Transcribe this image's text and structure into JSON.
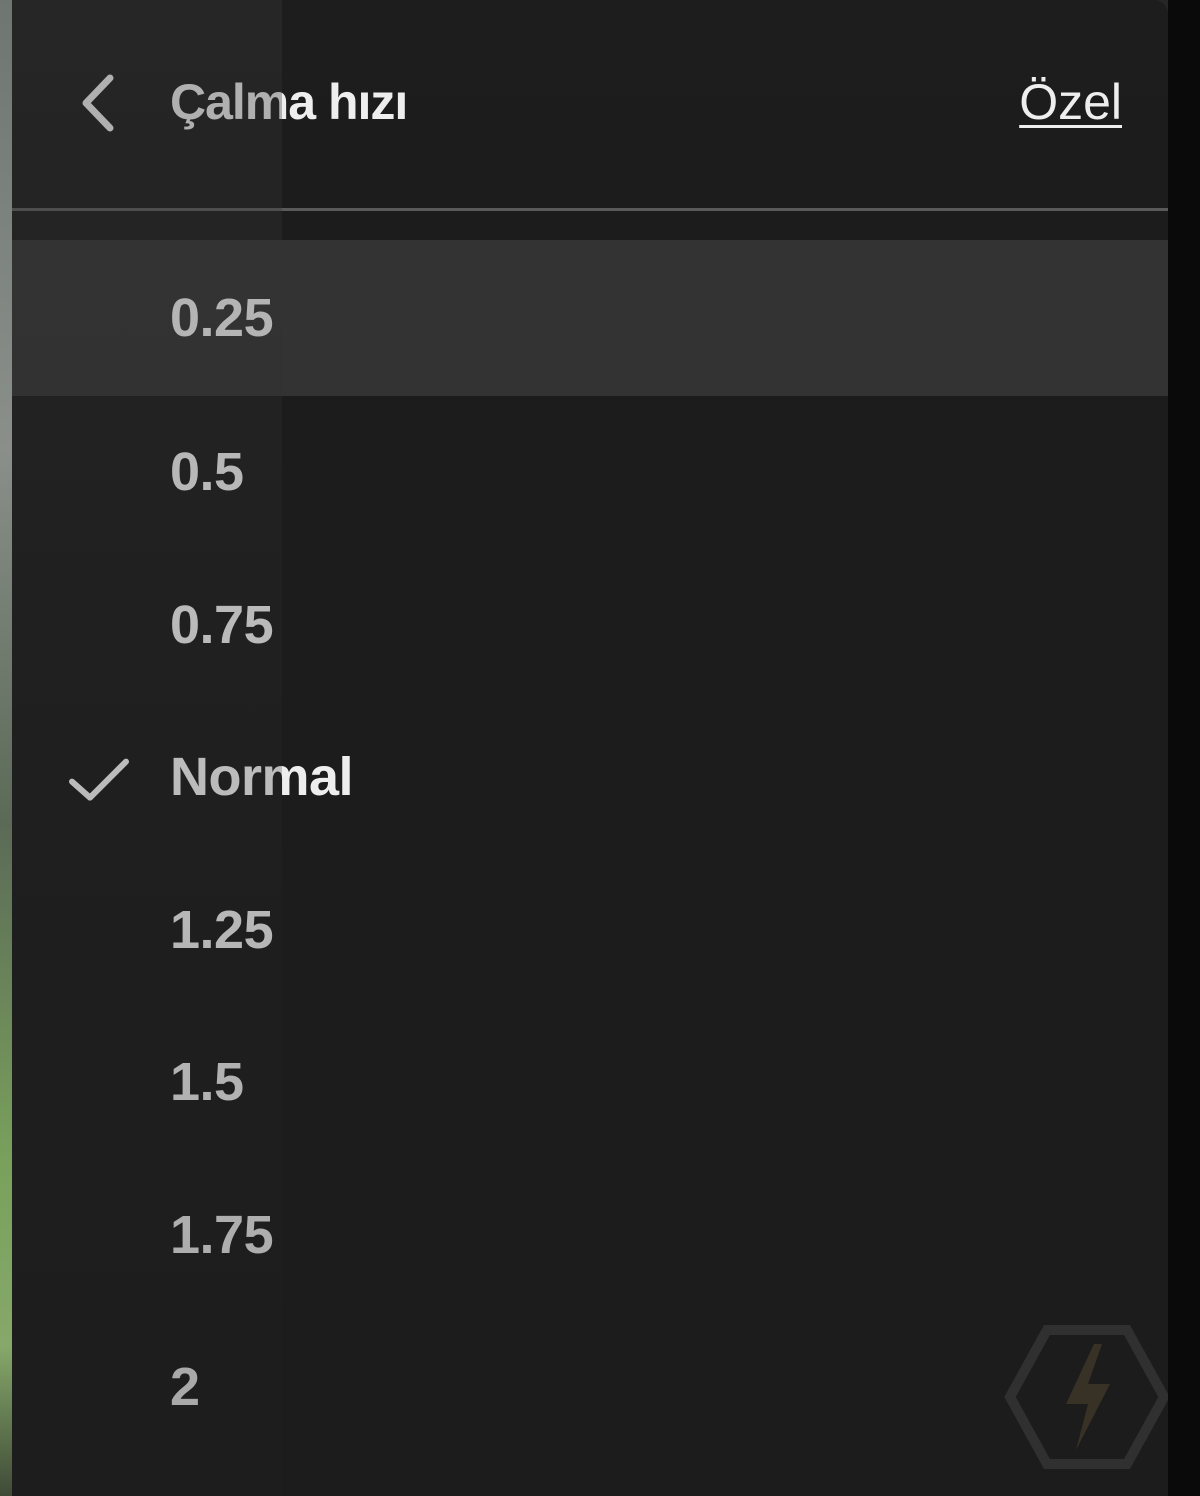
{
  "header": {
    "title": "Çalma hızı",
    "custom_label": "Özel",
    "back_icon": "chevron-left-icon"
  },
  "options": [
    {
      "label": "0.25",
      "selected": false,
      "highlighted": true
    },
    {
      "label": "0.5",
      "selected": false,
      "highlighted": false
    },
    {
      "label": "0.75",
      "selected": false,
      "highlighted": false
    },
    {
      "label": "Normal",
      "selected": true,
      "highlighted": false
    },
    {
      "label": "1.25",
      "selected": false,
      "highlighted": false
    },
    {
      "label": "1.5",
      "selected": false,
      "highlighted": false
    },
    {
      "label": "1.75",
      "selected": false,
      "highlighted": false
    },
    {
      "label": "2",
      "selected": false,
      "highlighted": false
    }
  ],
  "colors": {
    "panel_bg": "#1c1c1c",
    "highlight_bg": "#333333",
    "text": "#eeeeee",
    "divider": "#5a5a5a"
  },
  "icons": {
    "selected_marker": "checkmark-icon",
    "watermark": "hexagon-bolt-logo-icon"
  }
}
